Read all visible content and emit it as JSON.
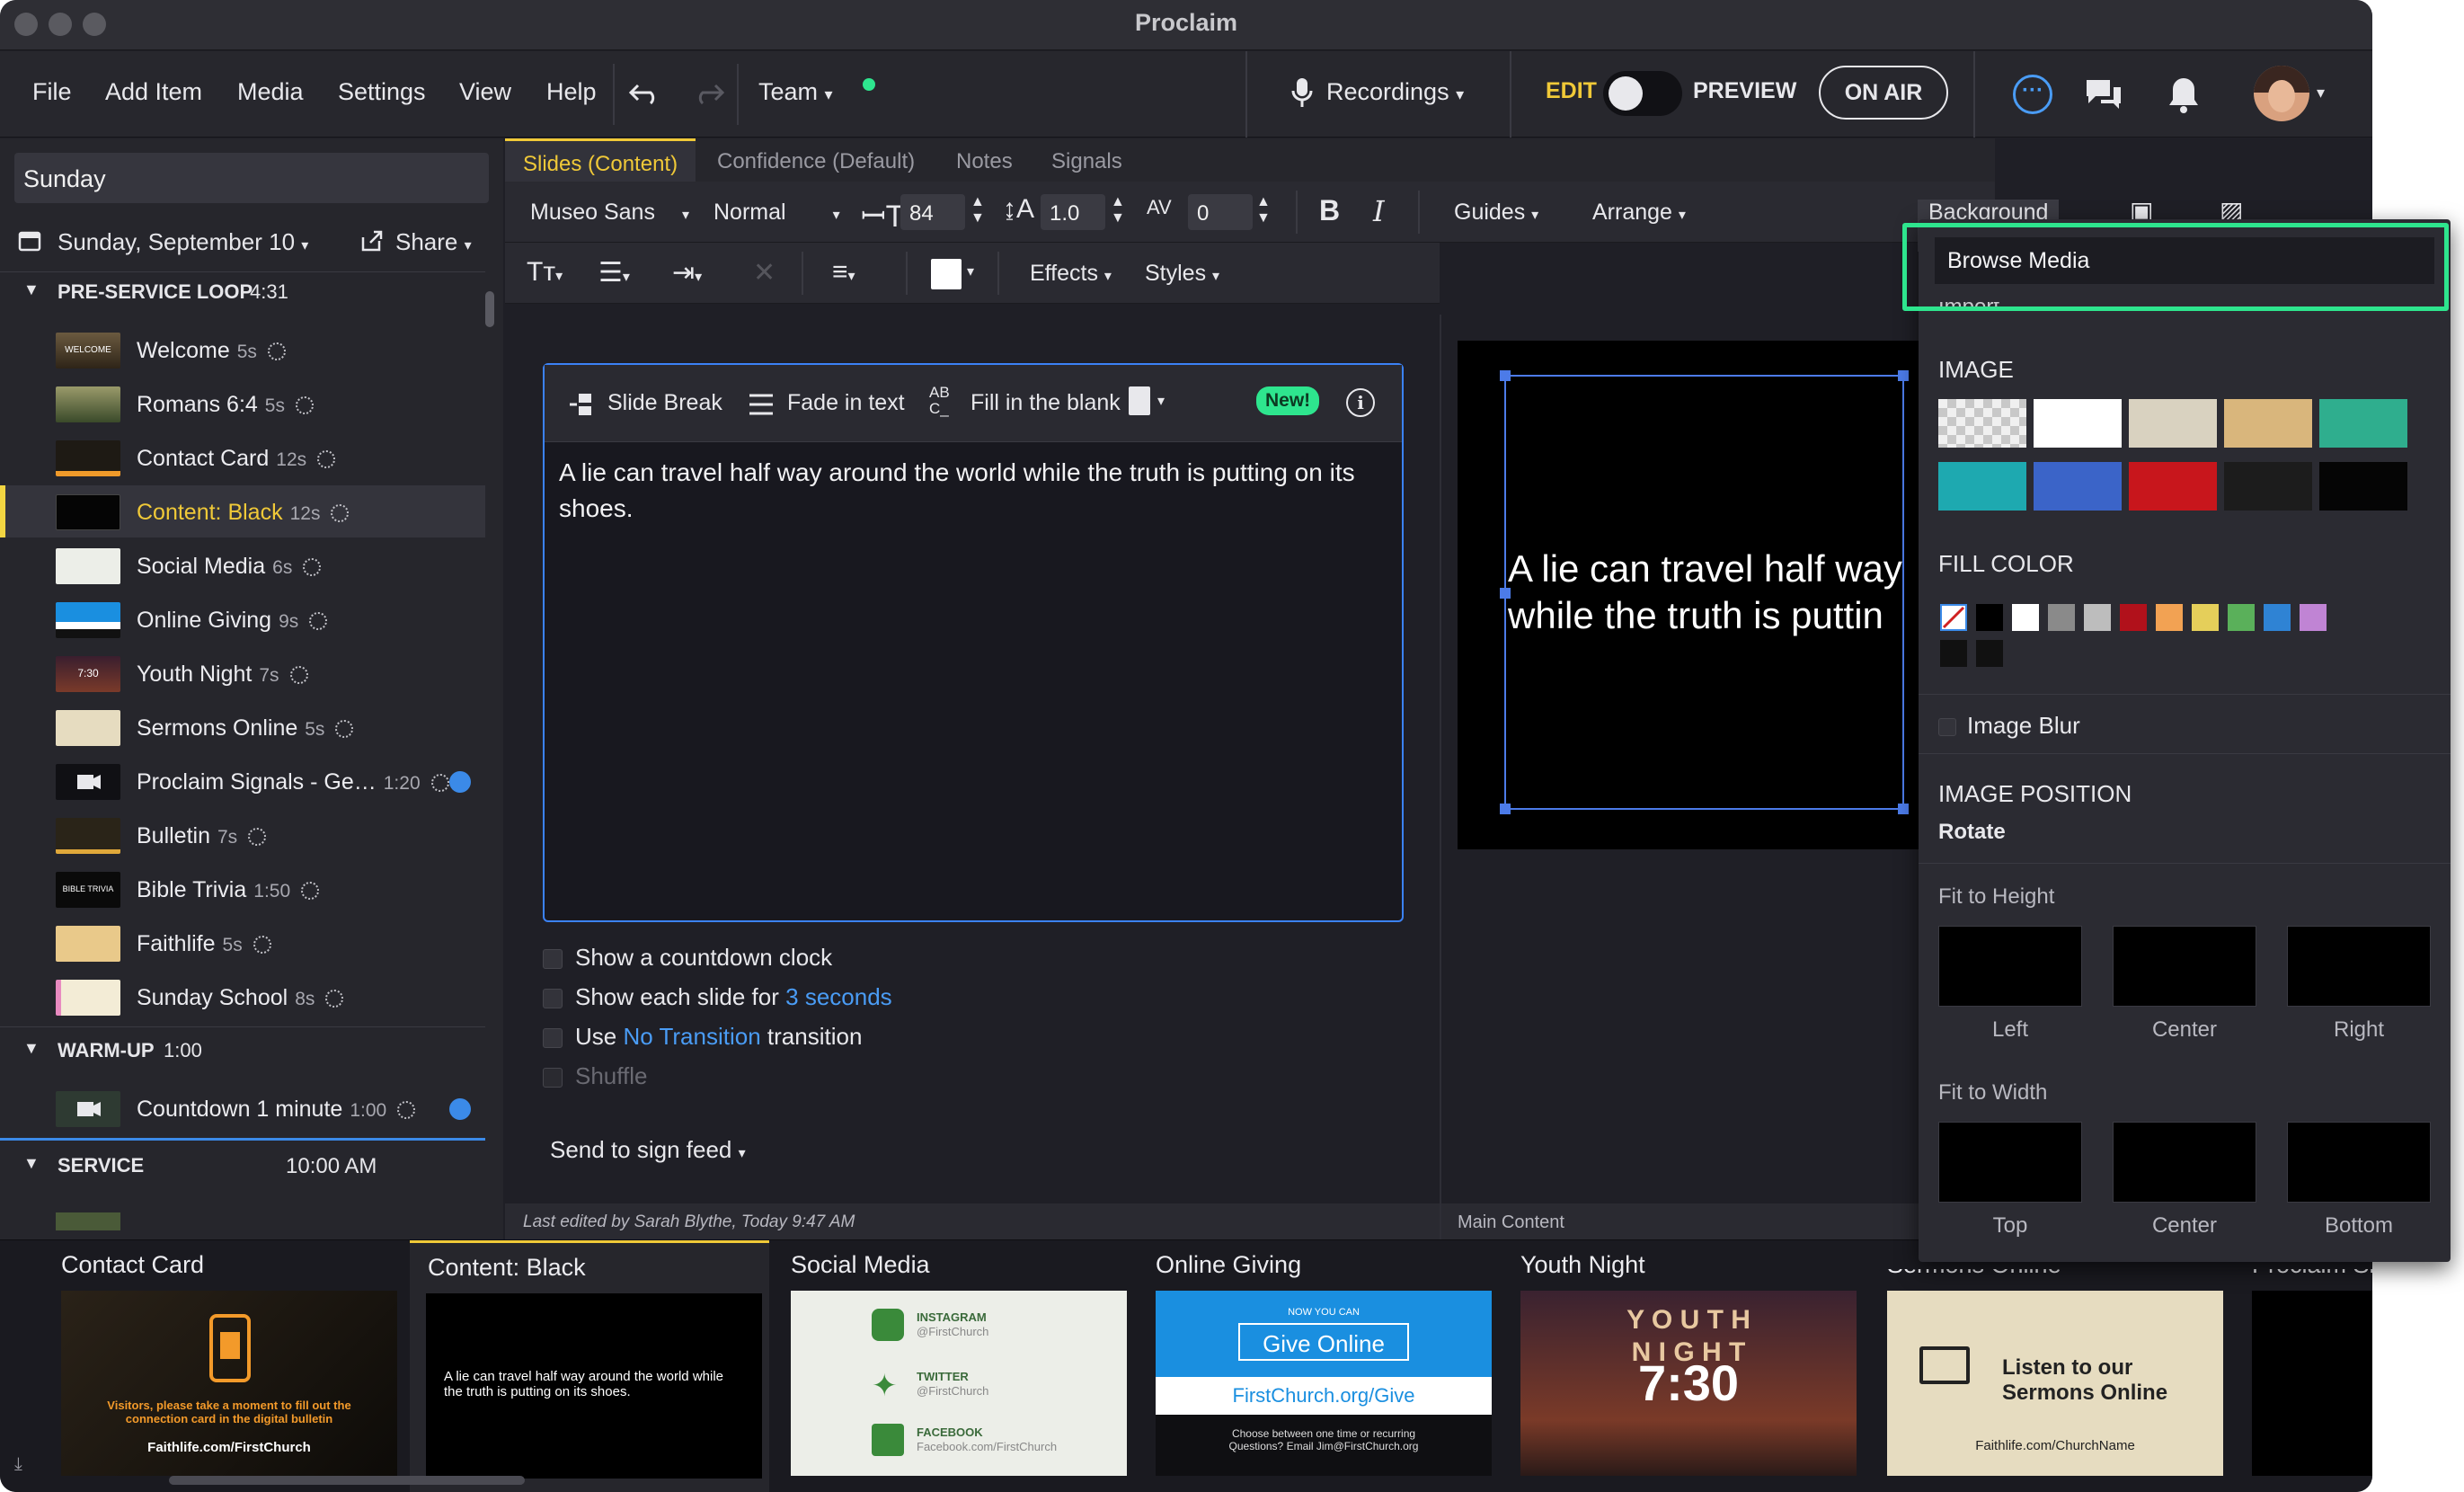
{
  "app": {
    "title": "Proclaim"
  },
  "menu": {
    "items": [
      "File",
      "Add Item",
      "Media",
      "Settings",
      "View",
      "Help"
    ],
    "team": "Team",
    "recordings": "Recordings",
    "edit": "EDIT",
    "preview": "PREVIEW",
    "on_air": "ON AIR"
  },
  "sidebar": {
    "service_name": "Sunday",
    "date": "Sunday, September 10",
    "share": "Share",
    "sections": [
      {
        "name": "PRE-SERVICE LOOP",
        "duration": "4:31"
      },
      {
        "name": "WARM-UP",
        "duration": "1:00"
      },
      {
        "name": "SERVICE",
        "time": "10:00 AM"
      }
    ],
    "items": [
      {
        "label": "Welcome",
        "duration": "5s"
      },
      {
        "label": "Romans 6:4",
        "duration": "5s"
      },
      {
        "label": "Contact Card",
        "duration": "12s"
      },
      {
        "label": "Content: Black",
        "duration": "12s"
      },
      {
        "label": "Social Media",
        "duration": "6s"
      },
      {
        "label": "Online Giving",
        "duration": "9s"
      },
      {
        "label": "Youth Night",
        "duration": "7s"
      },
      {
        "label": "Sermons Online",
        "duration": "5s"
      },
      {
        "label": "Proclaim Signals - Ge…",
        "duration": "1:20"
      },
      {
        "label": "Bulletin",
        "duration": "7s"
      },
      {
        "label": "Bible Trivia",
        "duration": "1:50"
      },
      {
        "label": "Faithlife",
        "duration": "5s"
      },
      {
        "label": "Sunday School",
        "duration": "8s"
      },
      {
        "label": "Countdown 1 minute",
        "duration": "1:00"
      }
    ],
    "thumb_texts": {
      "welcome": "WELCOME",
      "youth": "7:30",
      "bible": "BIBLE TRIVIA"
    }
  },
  "tabs": [
    "Slides (Content)",
    "Confidence (Default)",
    "Notes",
    "Signals"
  ],
  "toolbar": {
    "font": "Museo Sans",
    "weight": "Normal",
    "size": "84",
    "line_height": "1.0",
    "tracking": "0",
    "bold": "B",
    "italic": "I",
    "guides": "Guides",
    "arrange": "Arrange",
    "background": "Background",
    "effects": "Effects",
    "styles": "Styles"
  },
  "editor": {
    "slide_break": "Slide Break",
    "fade_in": "Fade in text",
    "fill_blank": "Fill in the blank",
    "new_badge": "New!",
    "text": "A lie can travel half way around the world while the truth is putting on its shoes."
  },
  "options": {
    "countdown": "Show a countdown clock",
    "each_slide": "Show each slide for",
    "seconds": "3 seconds",
    "use": "Use",
    "no_transition": "No Transition",
    "transition": "transition",
    "shuffle": "Shuffle",
    "send_sign": "Send to sign feed"
  },
  "status": {
    "edited": "Last edited by Sarah Blythe, Today 9:47 AM",
    "main_content": "Main Content"
  },
  "preview": {
    "line1": "A lie can travel half way",
    "line2": "while the truth is puttin"
  },
  "dropdown": {
    "browse": "Browse Media",
    "import_partial": "Import...",
    "image": "IMAGE",
    "fill_color": "FILL COLOR",
    "image_blur": "Image Blur",
    "image_position": "IMAGE POSITION",
    "rotate": "Rotate",
    "fit_height": "Fit to Height",
    "fit_width": "Fit to Width",
    "left": "Left",
    "center": "Center",
    "right": "Right",
    "top": "Top",
    "bottom": "Bottom",
    "image_swatches": [
      "#d8d8d8",
      "#ffffff",
      "#d9d2c0",
      "#d9b67c",
      "#2fae8e",
      "#1ea9b0",
      "#3b64c8",
      "#c8161c",
      "#1c1c1c",
      "#050505"
    ],
    "fill_colors": [
      "#000000",
      "#ffffff",
      "#8a8a8a",
      "#bdbdbd",
      "#b1111b",
      "#f2a253",
      "#e5cf5a",
      "#5ab05a",
      "#2f83d4",
      "#c084d4",
      "#111111",
      "#111111"
    ]
  },
  "strip": {
    "cards": [
      {
        "title": "Contact Card",
        "caption": "Visitors, please take a moment to fill out the connection card in the digital bulletin",
        "url": "Faithlife.com/FirstChurch"
      },
      {
        "title": "Content: Black",
        "caption": "A lie can travel half way around the world while the truth is putting on its shoes."
      },
      {
        "title": "Social Media",
        "instagram": "INSTAGRAM",
        "twitter": "TWITTER",
        "facebook": "FACEBOOK",
        "handle": "@FirstChurch",
        "fb_url": "Facebook.com/FirstChurch"
      },
      {
        "title": "Online Giving",
        "small": "NOW YOU CAN",
        "give": "Give Online",
        "url": "FirstChurch.org/Give",
        "note": "Choose between one time or recurring Questions? Email Jim@FirstChurch.org"
      },
      {
        "title": "Youth Night",
        "youth": "Y O U T H",
        "night": "N I G H T",
        "time": "7:30"
      },
      {
        "title": "Sermons Online",
        "listen": "Listen to our Sermons Online",
        "url": "Faithlife.com/ChurchName"
      },
      {
        "title": "Proclaim Si"
      }
    ]
  }
}
